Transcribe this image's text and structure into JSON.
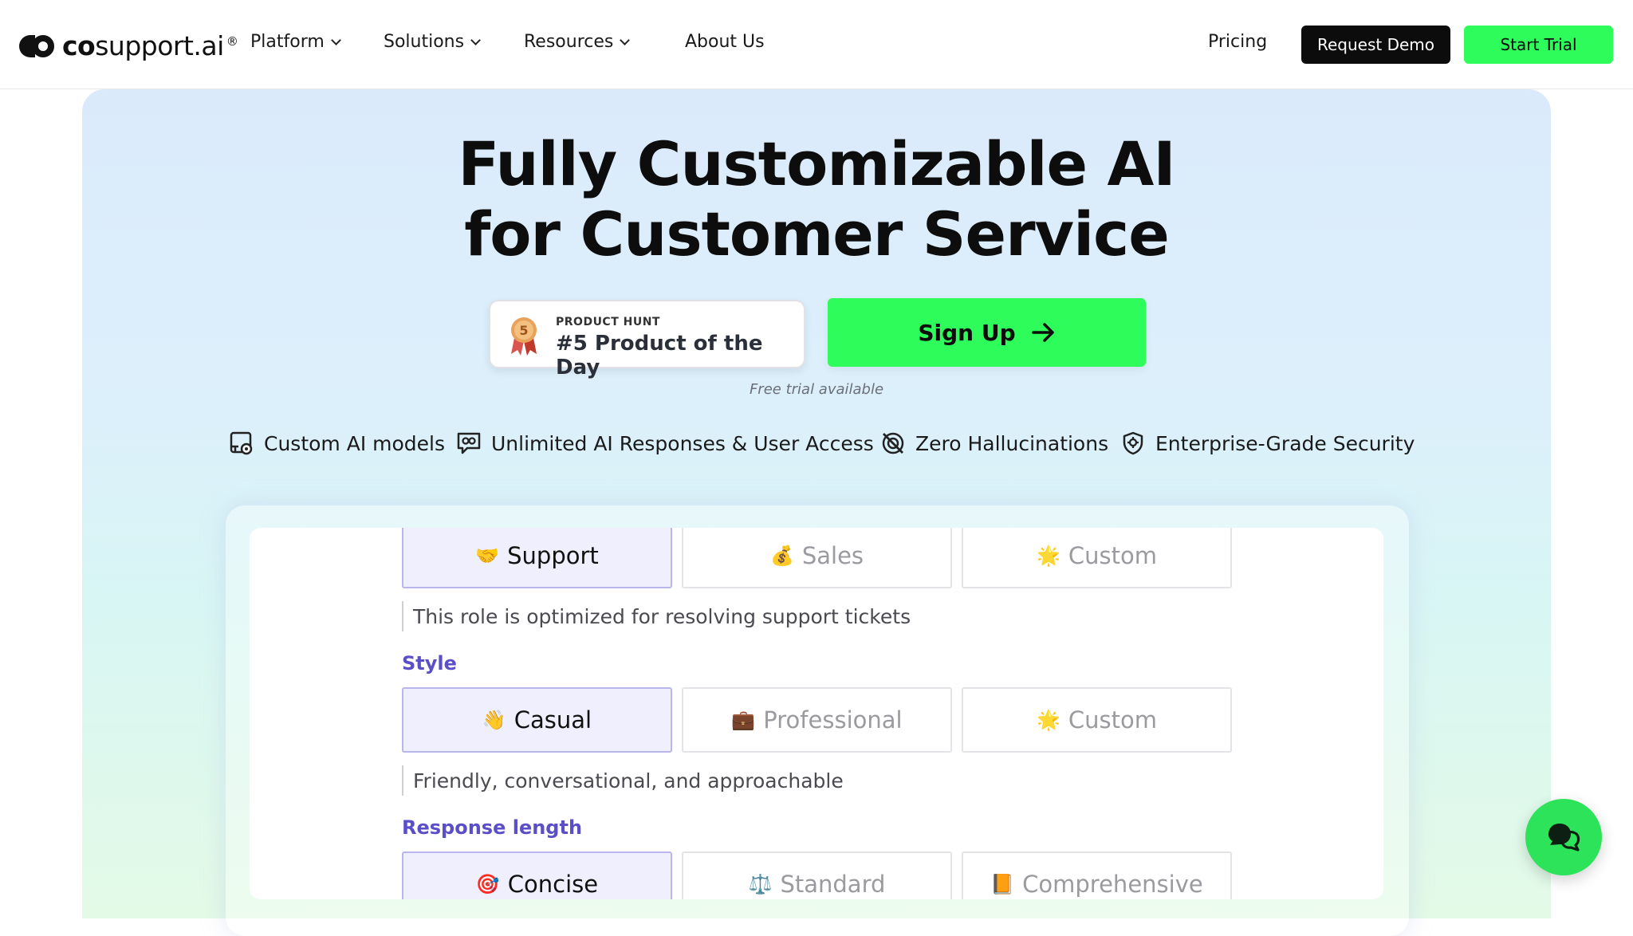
{
  "brand": {
    "name_bold": "co",
    "name_rest": "support.ai",
    "reg": "®"
  },
  "nav": {
    "items": [
      {
        "label": "Platform",
        "has_menu": true
      },
      {
        "label": "Solutions",
        "has_menu": true
      },
      {
        "label": "Resources",
        "has_menu": true
      },
      {
        "label": "About Us",
        "has_menu": false
      }
    ],
    "pricing": "Pricing",
    "request_demo": "Request Demo",
    "start_trial": "Start Trial"
  },
  "hero": {
    "title_line1": "Fully Customizable AI",
    "title_line2": "for Customer Service",
    "badge": {
      "rank": "5",
      "small": "PRODUCT HUNT",
      "big": "#5 Product of the Day"
    },
    "signup": "Sign Up",
    "free_trial": "Free trial available",
    "features": [
      {
        "label": "Custom AI models",
        "icon": "custom-model-icon"
      },
      {
        "label": "Unlimited AI Responses & User Access",
        "icon": "unlimited-chat-icon"
      },
      {
        "label": "Zero Hallucinations",
        "icon": "no-hallucination-icon"
      },
      {
        "label": "Enterprise-Grade Security",
        "icon": "shield-icon"
      }
    ]
  },
  "config": {
    "role": {
      "options": [
        {
          "emoji": "🤝",
          "label": "Support",
          "selected": true
        },
        {
          "emoji": "💰",
          "label": "Sales",
          "selected": false
        },
        {
          "emoji": "🌟",
          "label": "Custom",
          "selected": false
        }
      ],
      "description": "This role is optimized for resolving support tickets"
    },
    "style": {
      "heading": "Style",
      "options": [
        {
          "emoji": "👋",
          "label": "Casual",
          "selected": true
        },
        {
          "emoji": "💼",
          "label": "Professional",
          "selected": false
        },
        {
          "emoji": "🌟",
          "label": "Custom",
          "selected": false
        }
      ],
      "description": "Friendly, conversational, and approachable"
    },
    "length": {
      "heading": "Response length",
      "options": [
        {
          "emoji": "🎯",
          "label": "Concise",
          "selected": true
        },
        {
          "emoji": "⚖️",
          "label": "Standard",
          "selected": false
        },
        {
          "emoji": "📙",
          "label": "Comprehensive",
          "selected": false
        }
      ]
    }
  },
  "colors": {
    "accent_green": "#2efc5b",
    "dark": "#0c0c0c",
    "section_purple": "#5a4fc8",
    "selected_bg": "#f0effd"
  }
}
